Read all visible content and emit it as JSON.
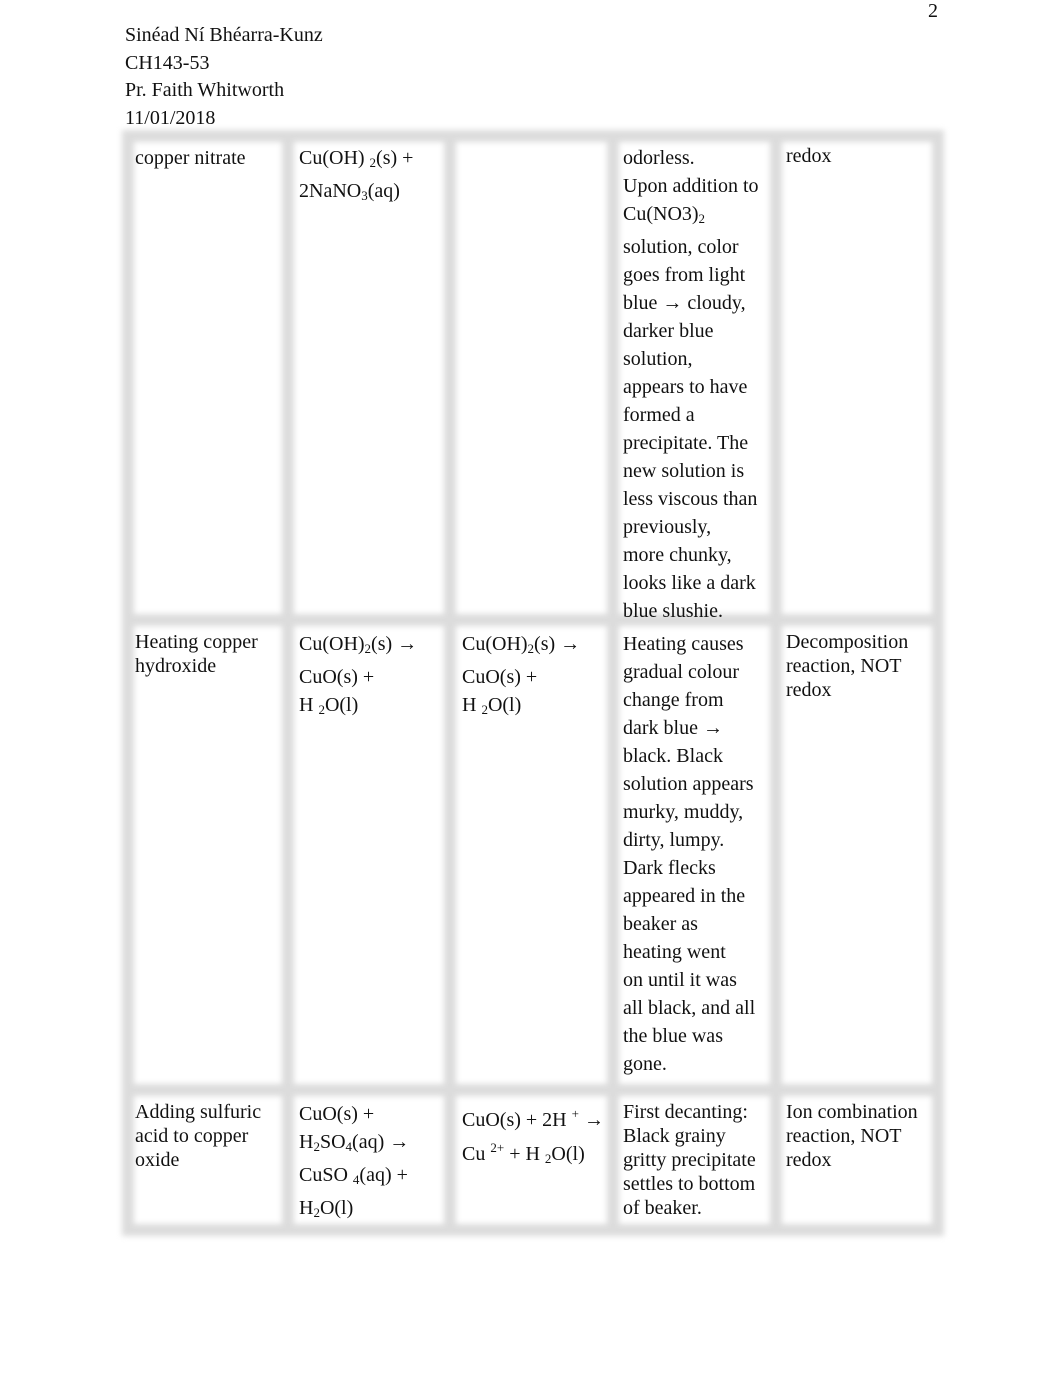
{
  "page_number": "2",
  "header": {
    "name": "Sinéad Ní Bhéarra-Kunz",
    "course": "CH143-53",
    "instructor": "Pr. Faith Whitworth",
    "date": "11/01/2018"
  },
  "rows": [
    {
      "cells": [
        [
          [
            [
              "copper nitrate",
              ""
            ]
          ]
        ],
        [
          [
            [
              "Cu(OH) ",
              ""
            ],
            [
              "2",
              "sub"
            ],
            [
              "(s) +",
              ""
            ]
          ],
          [
            [
              "2NaNO",
              ""
            ],
            [
              "3",
              "sub"
            ],
            [
              "(aq)",
              ""
            ]
          ]
        ],
        [],
        [
          [
            [
              "odorless.",
              ""
            ]
          ],
          [
            [
              "Upon addition to",
              ""
            ]
          ],
          [
            [
              "Cu(NO3)",
              ""
            ],
            [
              "2",
              "sub"
            ]
          ],
          [
            [
              "solution, color",
              ""
            ]
          ],
          [
            [
              "goes from light",
              ""
            ]
          ],
          [
            [
              "blue → cloudy,",
              ""
            ]
          ],
          [
            [
              "darker blue",
              ""
            ]
          ],
          [
            [
              "solution,",
              ""
            ]
          ],
          [
            [
              "appears to have",
              ""
            ]
          ],
          [
            [
              "formed a",
              ""
            ]
          ],
          [
            [
              "precipitate. The",
              ""
            ]
          ],
          [
            [
              "new solution is",
              ""
            ]
          ],
          [
            [
              "less viscous than",
              ""
            ]
          ],
          [
            [
              "previously,",
              ""
            ]
          ],
          [
            [
              "more chunky,",
              ""
            ]
          ],
          [
            [
              "looks like a dark",
              ""
            ]
          ],
          [
            [
              "blue slushie.",
              ""
            ]
          ]
        ],
        [
          [
            [
              "redox",
              ""
            ]
          ]
        ]
      ]
    },
    {
      "cells": [
        [
          [
            [
              "Heating copper",
              ""
            ]
          ],
          [
            [
              "hydroxide",
              ""
            ]
          ]
        ],
        [
          [
            [
              "Cu(OH)",
              ""
            ],
            [
              "2",
              "sub"
            ],
            [
              "(s) →",
              ""
            ]
          ],
          [
            [
              "CuO(s) +",
              ""
            ]
          ],
          [
            [
              "H ",
              ""
            ],
            [
              "2",
              "sub"
            ],
            [
              "O(l)",
              ""
            ]
          ]
        ],
        [
          [
            [
              "Cu(OH)",
              ""
            ],
            [
              "2",
              "sub"
            ],
            [
              "(s) →",
              ""
            ]
          ],
          [
            [
              "CuO(s) +",
              ""
            ]
          ],
          [
            [
              "H ",
              ""
            ],
            [
              "2",
              "sub"
            ],
            [
              "O(l)",
              ""
            ]
          ]
        ],
        [
          [
            [
              "Heating causes",
              ""
            ]
          ],
          [
            [
              "gradual colour",
              ""
            ]
          ],
          [
            [
              "change from",
              ""
            ]
          ],
          [
            [
              "dark blue →",
              ""
            ]
          ],
          [
            [
              "black. Black",
              ""
            ]
          ],
          [
            [
              "solution appears",
              ""
            ]
          ],
          [
            [
              "murky, muddy,",
              ""
            ]
          ],
          [
            [
              "dirty, lumpy.",
              ""
            ]
          ],
          [
            [
              "Dark flecks",
              ""
            ]
          ],
          [
            [
              "appeared in the",
              ""
            ]
          ],
          [
            [
              "beaker as",
              ""
            ]
          ],
          [
            [
              "heating went",
              ""
            ]
          ],
          [
            [
              "on until it was",
              ""
            ]
          ],
          [
            [
              "all black, and all",
              ""
            ]
          ],
          [
            [
              "the blue was",
              ""
            ]
          ],
          [
            [
              "gone.",
              ""
            ]
          ]
        ],
        [
          [
            [
              "Decomposition",
              ""
            ]
          ],
          [
            [
              "reaction, NOT",
              ""
            ]
          ],
          [
            [
              "redox",
              ""
            ]
          ]
        ]
      ]
    },
    {
      "cells": [
        [
          [
            [
              "Adding sulfuric",
              ""
            ]
          ],
          [
            [
              "acid to copper",
              ""
            ]
          ],
          [
            [
              "oxide",
              ""
            ]
          ]
        ],
        [
          [
            [
              "CuO(s) +",
              ""
            ]
          ],
          [
            [
              "H",
              ""
            ],
            [
              "2",
              "sub"
            ],
            [
              "SO",
              ""
            ],
            [
              "4",
              "sub"
            ],
            [
              "(aq) →",
              ""
            ]
          ],
          [
            [
              "CuSO ",
              ""
            ],
            [
              "4",
              "sub"
            ],
            [
              "(aq) +",
              ""
            ]
          ],
          [
            [
              "H",
              ""
            ],
            [
              "2",
              "sub"
            ],
            [
              "O(l)",
              ""
            ]
          ]
        ],
        [
          [
            [
              "CuO(s) + 2H ",
              ""
            ],
            [
              "+",
              "sup"
            ],
            [
              " →",
              ""
            ]
          ],
          [
            [
              "Cu ",
              ""
            ],
            [
              "2+",
              "sup"
            ],
            [
              " + H ",
              ""
            ],
            [
              "2",
              "sub"
            ],
            [
              "O(l)",
              ""
            ]
          ]
        ],
        [
          [
            [
              "First decanting:",
              ""
            ]
          ],
          [
            [
              "Black grainy",
              ""
            ]
          ],
          [
            [
              "gritty precipitate",
              ""
            ]
          ],
          [
            [
              "settles to bottom",
              ""
            ]
          ],
          [
            [
              "of beaker.",
              ""
            ]
          ]
        ],
        [
          [
            [
              "Ion combination",
              ""
            ]
          ],
          [
            [
              "reaction, NOT",
              ""
            ]
          ],
          [
            [
              "redox",
              ""
            ]
          ]
        ]
      ]
    }
  ]
}
